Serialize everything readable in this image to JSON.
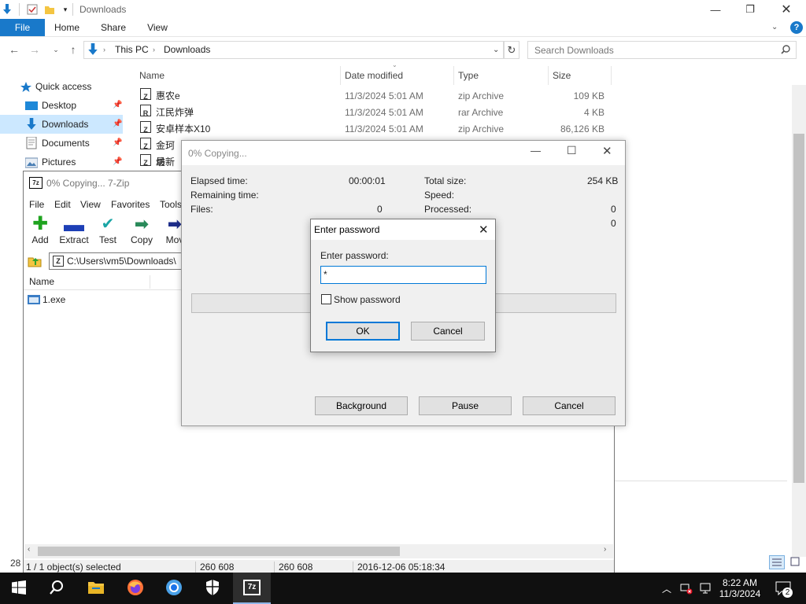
{
  "explorer": {
    "title": "Downloads",
    "ribbon_tabs": [
      "File",
      "Home",
      "Share",
      "View"
    ],
    "help_glyph": "?",
    "breadcrumb": [
      "This PC",
      "Downloads"
    ],
    "search_placeholder": "Search Downloads",
    "nav_items": [
      {
        "label": "Quick access",
        "icon": "star-icon"
      },
      {
        "label": "Desktop",
        "icon": "desktop-icon",
        "pinned": true
      },
      {
        "label": "Downloads",
        "icon": "download-arrow-icon",
        "pinned": true,
        "selected": true
      },
      {
        "label": "Documents",
        "icon": "documents-icon",
        "pinned": true
      },
      {
        "label": "Pictures",
        "icon": "pictures-icon",
        "pinned": true
      }
    ],
    "columns": [
      "Name",
      "Date modified",
      "Type",
      "Size"
    ],
    "files": [
      {
        "name": "惠农e",
        "date": "11/3/2024 5:01 AM",
        "type": "zip Archive",
        "size": "109 KB",
        "badge": "Z"
      },
      {
        "name": "江民炸弹",
        "date": "11/3/2024 5:01 AM",
        "type": "rar Archive",
        "size": "4 KB",
        "badge": "R"
      },
      {
        "name": "安卓样本X10",
        "date": "11/3/2024 5:01 AM",
        "type": "zip Archive",
        "size": "86,126 KB",
        "badge": "Z"
      },
      {
        "name": "金珂坊",
        "badge": "Z"
      },
      {
        "name": "最新鬼",
        "badge": "Z"
      }
    ],
    "item_count_fragment": "28",
    "colors": {
      "accent": "#1979ca",
      "selected": "#cce8ff"
    }
  },
  "sevenzip": {
    "title": "0% Copying... 7-Zip",
    "menu": [
      "File",
      "Edit",
      "View",
      "Favorites",
      "Tools"
    ],
    "toolbar": [
      {
        "label": "Add",
        "icon": "plus-icon",
        "color": "#1fa31f"
      },
      {
        "label": "Extract",
        "icon": "minus-icon",
        "color": "#1d3fb6"
      },
      {
        "label": "Test",
        "icon": "check-icon",
        "color": "#1aa5a5"
      },
      {
        "label": "Copy",
        "icon": "copy-arrow-icon",
        "color": "#2a8a5a"
      },
      {
        "label": "Mov",
        "icon": "move-arrow-icon",
        "color": "#1d2d8a"
      }
    ],
    "path": "C:\\Users\\vm5\\Downloads\\",
    "column_name": "Name",
    "files": [
      {
        "name": "1.exe"
      }
    ],
    "status": [
      "1 / 1 object(s) selected",
      "260 608",
      "260 608",
      "2016-12-06 05:18:34"
    ]
  },
  "progress": {
    "title": "0% Copying...",
    "elapsed_label": "Elapsed time:",
    "elapsed_value": "00:00:01",
    "remaining_label": "Remaining time:",
    "files_label": "Files:",
    "files_value": "0",
    "total_size_label": "Total size:",
    "total_size_value": "254 KB",
    "speed_label": "Speed:",
    "processed_label": "Processed:",
    "processed_value": "0",
    "extra_value": "0",
    "progress_fraction": 0,
    "buttons": {
      "background": "Background",
      "pause": "Pause",
      "cancel": "Cancel"
    }
  },
  "password_dialog": {
    "title": "Enter password",
    "prompt": "Enter password:",
    "value": "*",
    "show_password_label": "Show password",
    "show_password_checked": false,
    "ok": "OK",
    "cancel": "Cancel"
  },
  "taskbar": {
    "apps": [
      {
        "name": "start",
        "icon": "windows-logo-icon"
      },
      {
        "name": "search",
        "icon": "search-icon"
      },
      {
        "name": "file-explorer",
        "icon": "folder-icon"
      },
      {
        "name": "firefox",
        "icon": "firefox-icon"
      },
      {
        "name": "chrome",
        "icon": "chrome-icon"
      },
      {
        "name": "security",
        "icon": "shield-icon"
      },
      {
        "name": "7zip",
        "icon": "7zip-icon",
        "active": true
      }
    ],
    "time": "8:22 AM",
    "date": "11/3/2024",
    "notification_count": "2"
  }
}
